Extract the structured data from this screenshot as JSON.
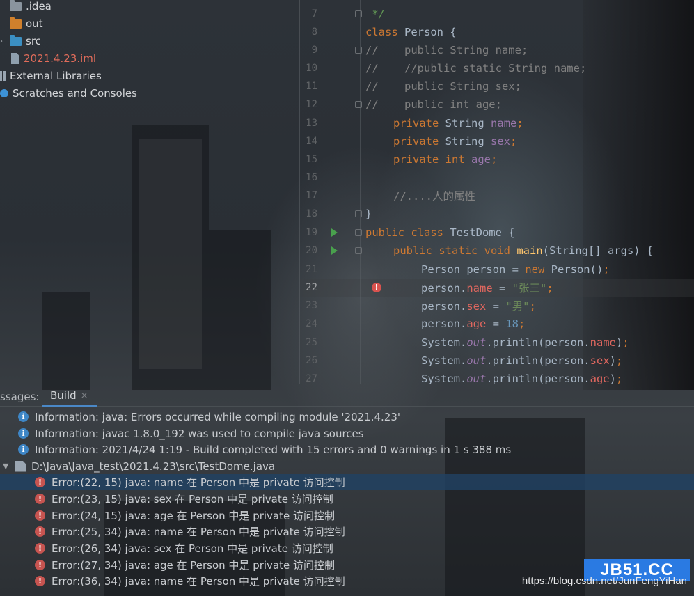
{
  "colors": {
    "accent": "#4a88c7",
    "error": "#c75450",
    "info": "#3e86c6",
    "watermark_bg": "#2a7ae2"
  },
  "project_tree": {
    "items": [
      {
        "label": ".idea",
        "icon": "folder-icon"
      },
      {
        "label": "out",
        "icon": "folder-orange-icon"
      },
      {
        "label": "src",
        "icon": "folder-blue-icon"
      },
      {
        "label": "2021.4.23.iml",
        "icon": "module-file-icon"
      },
      {
        "label": "External Libraries",
        "icon": "library-icon"
      },
      {
        "label": "Scratches and Consoles",
        "icon": "scratches-icon"
      }
    ]
  },
  "editor": {
    "current_line": "22",
    "lines": [
      {
        "n": "7"
      },
      {
        "n": "8"
      },
      {
        "n": "9"
      },
      {
        "n": "10"
      },
      {
        "n": "11"
      },
      {
        "n": "12"
      },
      {
        "n": "13"
      },
      {
        "n": "14"
      },
      {
        "n": "15"
      },
      {
        "n": "16"
      },
      {
        "n": "17"
      },
      {
        "n": "18"
      },
      {
        "n": "19"
      },
      {
        "n": "20"
      },
      {
        "n": "21"
      },
      {
        "n": "22"
      },
      {
        "n": "23"
      },
      {
        "n": "24"
      },
      {
        "n": "25"
      },
      {
        "n": "26"
      },
      {
        "n": "27"
      }
    ],
    "code": {
      "l7": " */",
      "l8_kw": "class",
      "l8_rest": " Person {",
      "l9": "//    public String name;",
      "l10": "//    //public static String name;",
      "l11": "//    public String sex;",
      "l12": "//    public int age;",
      "l13_kw": "private",
      "l13_type": " String ",
      "l13_field": "name",
      "l13_end": ";",
      "l14_kw": "private",
      "l14_type": " String ",
      "l14_field": "sex",
      "l14_end": ";",
      "l15_kw": "private int",
      "l15_sp": " ",
      "l15_field": "age",
      "l15_end": ";",
      "l17": "//....人的属性",
      "l18": "}",
      "l19_kw": "public class",
      "l19_rest": " TestDome {",
      "l20_kw": "public static void",
      "l20_sp": " ",
      "l20_method": "main",
      "l20_rest": "(String[] args) {",
      "l21_a": "Person person = ",
      "l21_kw": "new",
      "l21_b": " Person()",
      "l21_end": ";",
      "l22_a": "person.",
      "l22_field": "name",
      "l22_b": " = ",
      "l22_str": "\"张三\"",
      "l22_end": ";",
      "l23_a": "person.",
      "l23_field": "sex",
      "l23_b": " = ",
      "l23_str": "\"男\"",
      "l23_end": ";",
      "l24_a": "person.",
      "l24_field": "age",
      "l24_b": " = ",
      "l24_num": "18",
      "l24_end": ";",
      "l25_a": "System.",
      "l25_static": "out",
      "l25_b": ".println(person.",
      "l25_field": "name",
      "l25_c": ")",
      "l25_end": ";",
      "l26_a": "System.",
      "l26_static": "out",
      "l26_b": ".println(person.",
      "l26_field": "sex",
      "l26_c": ")",
      "l26_end": ";",
      "l27_a": "System.",
      "l27_static": "out",
      "l27_b": ".println(person.",
      "l27_field": "age",
      "l27_c": ")",
      "l27_end": ";"
    }
  },
  "build_panel": {
    "messages_label": "ssages:",
    "tab_label": "Build",
    "tab_close": "×",
    "info": [
      "Information: java: Errors occurred while compiling module '2021.4.23'",
      "Information: javac 1.8.0_192 was used to compile java sources",
      "Information: 2021/4/24 1:19 - Build completed with 15 errors and 0 warnings in 1 s 388 ms"
    ],
    "file_path": "D:\\Java\\Java_test\\2021.4.23\\src\\TestDome.java",
    "errors": [
      "Error:(22, 15)  java: name 在 Person 中是 private 访问控制",
      "Error:(23, 15)  java: sex 在 Person 中是 private 访问控制",
      "Error:(24, 15)  java: age 在 Person 中是 private 访问控制",
      "Error:(25, 34)  java: name 在 Person 中是 private 访问控制",
      "Error:(26, 34)  java: sex 在 Person 中是 private 访问控制",
      "Error:(27, 34)  java: age 在 Person 中是 private 访问控制",
      "Error:(36, 34)  java: name 在 Person 中是 private 访问控制"
    ]
  },
  "watermark": {
    "badge": "JB51.CC",
    "url": "https://blog.csdn.net/JunFengYiHan"
  }
}
